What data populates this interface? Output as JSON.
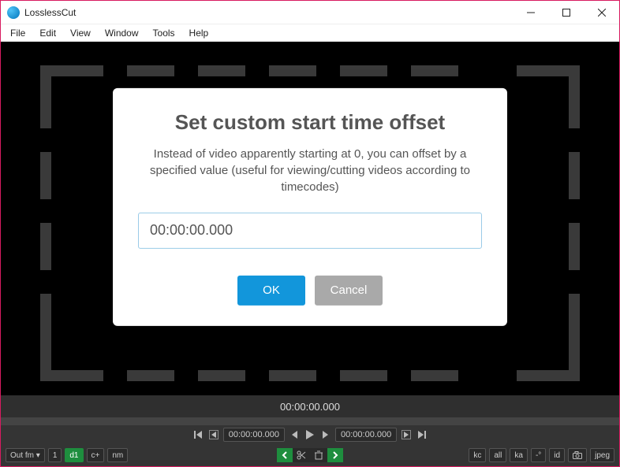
{
  "window": {
    "title": "LosslessCut"
  },
  "menu": {
    "items": [
      "File",
      "Edit",
      "View",
      "Window",
      "Tools",
      "Help"
    ]
  },
  "dialog": {
    "title": "Set custom start time offset",
    "description": "Instead of video apparently starting at 0, you can offset by a specified value (useful for viewing/cutting videos according to timecodes)",
    "input_value": "00:00:00.000",
    "ok_label": "OK",
    "cancel_label": "Cancel"
  },
  "timeline": {
    "current_time": "00:00:00.000"
  },
  "controls": {
    "start_time": "00:00:00.000",
    "end_time": "00:00:00.000"
  },
  "bottom": {
    "out_format": "Out fm ▾",
    "seg_num": "1",
    "chips_left": [
      "d1",
      "c+",
      "nm"
    ],
    "chips_right": [
      "kc",
      "all",
      "ka",
      "-°",
      "id",
      "jpeg"
    ]
  }
}
